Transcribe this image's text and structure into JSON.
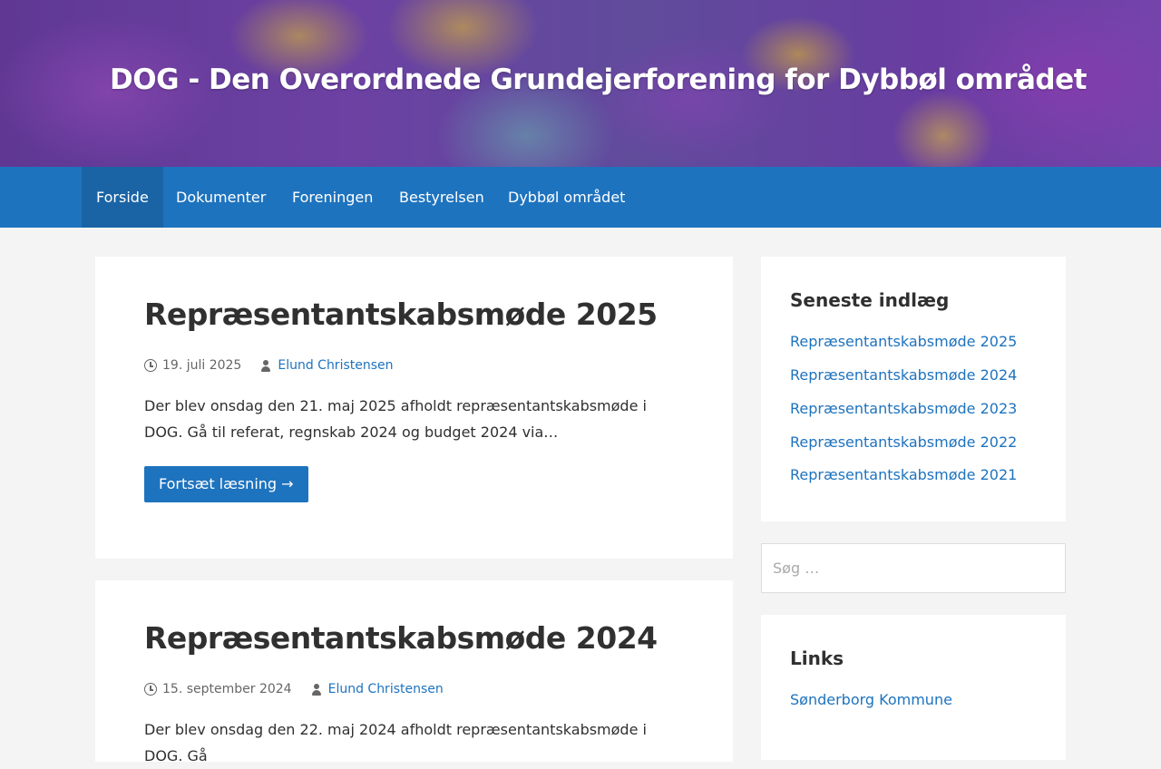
{
  "site": {
    "title": "DOG - Den Overordnede Grundejerforening for Dybbøl området"
  },
  "nav": {
    "items": [
      {
        "label": "Forside",
        "active": true
      },
      {
        "label": "Dokumenter"
      },
      {
        "label": "Foreningen"
      },
      {
        "label": "Bestyrelsen"
      },
      {
        "label": "Dybbøl området"
      }
    ]
  },
  "posts": [
    {
      "title": "Repræsentantskabsmøde 2025",
      "date": "19. juli 2025",
      "author": "Elund Christensen",
      "excerpt": "Der blev onsdag den 21. maj 2025 afholdt repræsentantskabsmøde i DOG. Gå til referat, regnskab 2024 og budget 2024 via…",
      "read_more": "Fortsæt læsning →"
    },
    {
      "title": "Repræsentantskabsmøde 2024",
      "date": "15. september 2024",
      "author": "Elund Christensen",
      "excerpt": "Der blev onsdag den 22. maj 2024 afholdt repræsentantskabsmøde i DOG. Gå"
    }
  ],
  "sidebar": {
    "recent": {
      "title": "Seneste indlæg",
      "items": [
        "Repræsentantskabsmøde 2025",
        "Repræsentantskabsmøde 2024",
        "Repræsentantskabsmøde 2023",
        "Repræsentantskabsmøde 2022",
        "Repræsentantskabsmøde 2021"
      ]
    },
    "search": {
      "placeholder": "Søg …"
    },
    "links": {
      "title": "Links",
      "items": [
        "Sønderborg Kommune"
      ]
    }
  },
  "colors": {
    "accent": "#1e73be",
    "nav_active": "#1a64a6",
    "background": "#f4f4f4"
  }
}
